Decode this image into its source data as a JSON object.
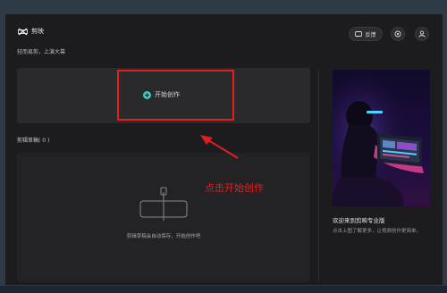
{
  "app": {
    "name": "剪映",
    "slogan": "轻而易剪，上演大幕"
  },
  "header": {
    "feedback_label": "反馈"
  },
  "start": {
    "label": "开始创作"
  },
  "drafts": {
    "title": "剪辑草稿( 0 )",
    "empty_text": "剪辑草稿会自动保存，开始创作吧"
  },
  "promo": {
    "title": "欢迎来到剪映专业版",
    "subtitle": "点击上图了解更多，让视频创作更简单。"
  },
  "annotation": {
    "text": "点击开始创作"
  },
  "colors": {
    "accent": "#2ad1c9",
    "annotation": "#e02020",
    "window_bg": "#1c1c1e"
  },
  "icons": [
    "capcut-logo-icon",
    "feedback-icon",
    "settings-icon",
    "account-icon",
    "plus-icon",
    "empty-drafts-icon"
  ]
}
